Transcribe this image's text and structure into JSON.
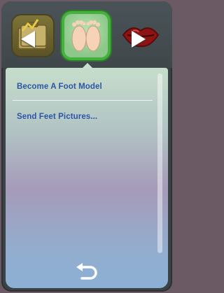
{
  "header": {
    "categories": [
      {
        "name": "career-category",
        "icon": "briefcase-icon"
      },
      {
        "name": "feet-category",
        "icon": "feet-icon",
        "selected": true
      },
      {
        "name": "romance-category",
        "icon": "lips-icon"
      }
    ]
  },
  "menu": {
    "items": [
      {
        "label": "Become A Foot Model"
      },
      {
        "label": "Send Feet Pictures..."
      }
    ]
  },
  "footer": {
    "back_icon": "back-arrow-icon"
  },
  "colors": {
    "selected_border": "#46b13e",
    "item_text": "#2d55a5"
  }
}
